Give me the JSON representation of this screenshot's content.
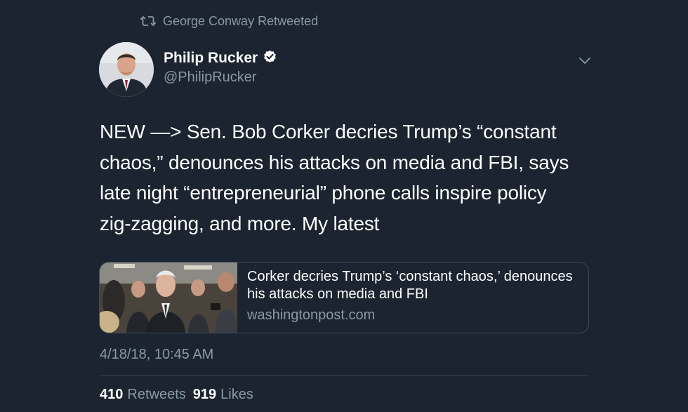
{
  "retweet": {
    "icon": "retweet-icon",
    "label": "George Conway Retweeted"
  },
  "author": {
    "name": "Philip Rucker",
    "handle": "@PhilipRucker",
    "verified_icon": "verified-badge-icon"
  },
  "tweet": {
    "text": "NEW —> Sen. Bob Corker decries Trump’s “constant\nchaos,” denounces his attacks on media and FBI, says\nlate night “entrepreneurial” phone calls inspire policy\nzig-zagging, and more. My latest"
  },
  "card": {
    "title": "Corker decries Trump’s ‘constant chaos,’ denounces his attacks on media and FBI",
    "domain": "washingtonpost.com"
  },
  "timestamp": "4/18/18, 10:45 AM",
  "stats": {
    "retweets_count": "410",
    "retweets_label": "Retweets",
    "likes_count": "919",
    "likes_label": "Likes"
  },
  "colors": {
    "background": "#1b2430",
    "secondary_text": "#8899a6",
    "primary_text": "#ffffff",
    "border": "#3d4b59"
  }
}
